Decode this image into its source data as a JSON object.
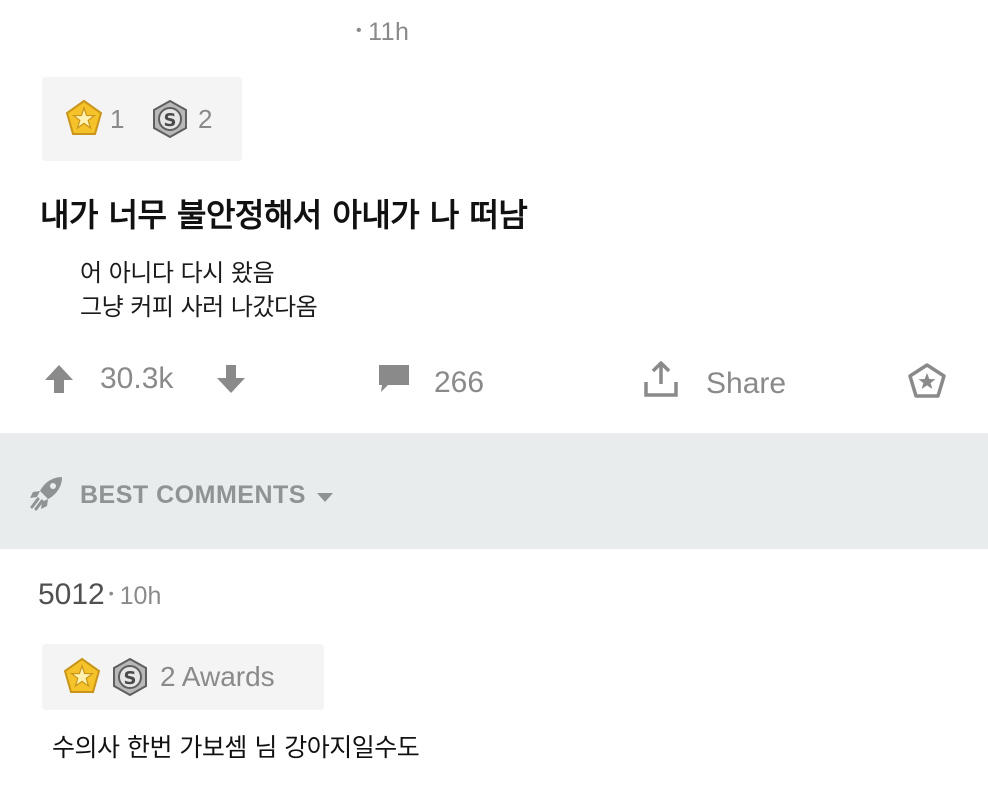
{
  "post": {
    "time": "11h",
    "awards": [
      {
        "icon": "gold-star-award-icon",
        "count": "1"
      },
      {
        "icon": "silver-award-icon",
        "count": "2"
      }
    ],
    "title": "내가 너무 불안정해서 아내가 나 떠남",
    "body_lines": [
      "어 아니다 다시 왔음",
      "그냥 커피 사러 나갔다옴"
    ],
    "score": "30.3k",
    "comments_count": "266",
    "share_label": "Share"
  },
  "comments_sort": {
    "label": "BEST COMMENTS"
  },
  "comment": {
    "author": "5012",
    "time": "10h",
    "awards_label": "2 Awards",
    "body": "수의사 한번 가보셈 님 강아지일수도"
  },
  "colors": {
    "award_gold": "#f5c22a",
    "award_silver": "#9c9c9c",
    "muted_text": "#8a8a8a",
    "band_bg": "#e8ecec"
  }
}
